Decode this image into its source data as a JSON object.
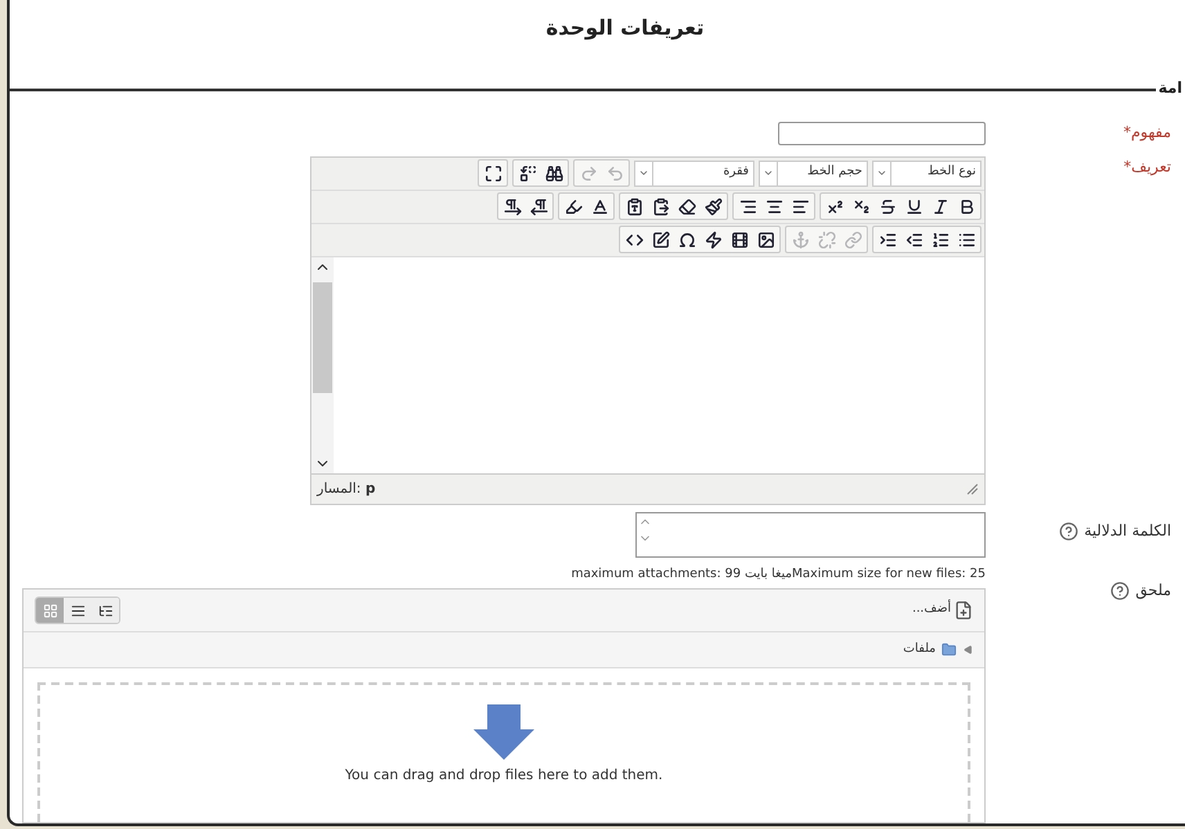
{
  "page_title": "تعريفات الوحدة",
  "section": {
    "legend": "امة"
  },
  "concept": {
    "label": "مفهوم*",
    "required": true
  },
  "definition": {
    "label": "تعريف*",
    "required": true,
    "selects": [
      {
        "label": "نوع الخط"
      },
      {
        "label": "حجم الخط"
      },
      {
        "label": "فقرة"
      }
    ],
    "toolbar_rows": [
      [
        [
          {
            "kind": "undo",
            "disabled": true
          },
          {
            "kind": "redo",
            "disabled": true
          }
        ],
        [
          {
            "kind": "find",
            "disabled": false
          },
          {
            "kind": "replace",
            "disabled": false
          }
        ],
        [
          {
            "kind": "fullscreen",
            "disabled": false
          }
        ]
      ],
      [
        [
          {
            "kind": "bold",
            "disabled": false
          },
          {
            "kind": "italic",
            "disabled": false
          },
          {
            "kind": "underline",
            "disabled": false
          },
          {
            "kind": "strike",
            "disabled": false
          },
          {
            "kind": "subscript",
            "disabled": false
          },
          {
            "kind": "superscript",
            "disabled": false
          }
        ],
        [
          {
            "kind": "align-left",
            "disabled": false
          },
          {
            "kind": "align-center",
            "disabled": false
          },
          {
            "kind": "align-right",
            "disabled": false
          }
        ],
        [
          {
            "kind": "clean",
            "disabled": false
          },
          {
            "kind": "erase",
            "disabled": false
          },
          {
            "kind": "paste-word",
            "disabled": false
          },
          {
            "kind": "paste-text",
            "disabled": false
          }
        ],
        [
          {
            "kind": "font-color",
            "disabled": false
          },
          {
            "kind": "highlight",
            "disabled": false
          }
        ],
        [
          {
            "kind": "ltr",
            "disabled": false
          },
          {
            "kind": "rtl",
            "disabled": false
          }
        ]
      ],
      [
        [
          {
            "kind": "bullets",
            "disabled": false
          },
          {
            "kind": "numbers",
            "disabled": false
          },
          {
            "kind": "outdent",
            "disabled": false
          },
          {
            "kind": "indent",
            "disabled": false
          }
        ],
        [
          {
            "kind": "link",
            "disabled": true
          },
          {
            "kind": "unlink",
            "disabled": true
          },
          {
            "kind": "anchor",
            "disabled": true
          }
        ],
        [
          {
            "kind": "image",
            "disabled": false
          },
          {
            "kind": "media",
            "disabled": false
          },
          {
            "kind": "flash",
            "disabled": false
          },
          {
            "kind": "symbol",
            "disabled": false
          },
          {
            "kind": "edit",
            "disabled": false
          },
          {
            "kind": "html",
            "disabled": false
          }
        ]
      ]
    ],
    "path": "المسار: **p**"
  },
  "keywords": {
    "label": "الكلمة الدلالية"
  },
  "attachment": {
    "label": "ملحق",
    "info": "maximum attachments: 99 ميغا بايتMaximum size for new files: 25",
    "add": "أضف...",
    "folder": "ملفات",
    "views": [
      {
        "kind": "icons",
        "selected": true
      },
      {
        "kind": "list",
        "selected": false
      },
      {
        "kind": "tree",
        "selected": false
      }
    ],
    "drop_text": "You can drag and drop files here to add them."
  }
}
